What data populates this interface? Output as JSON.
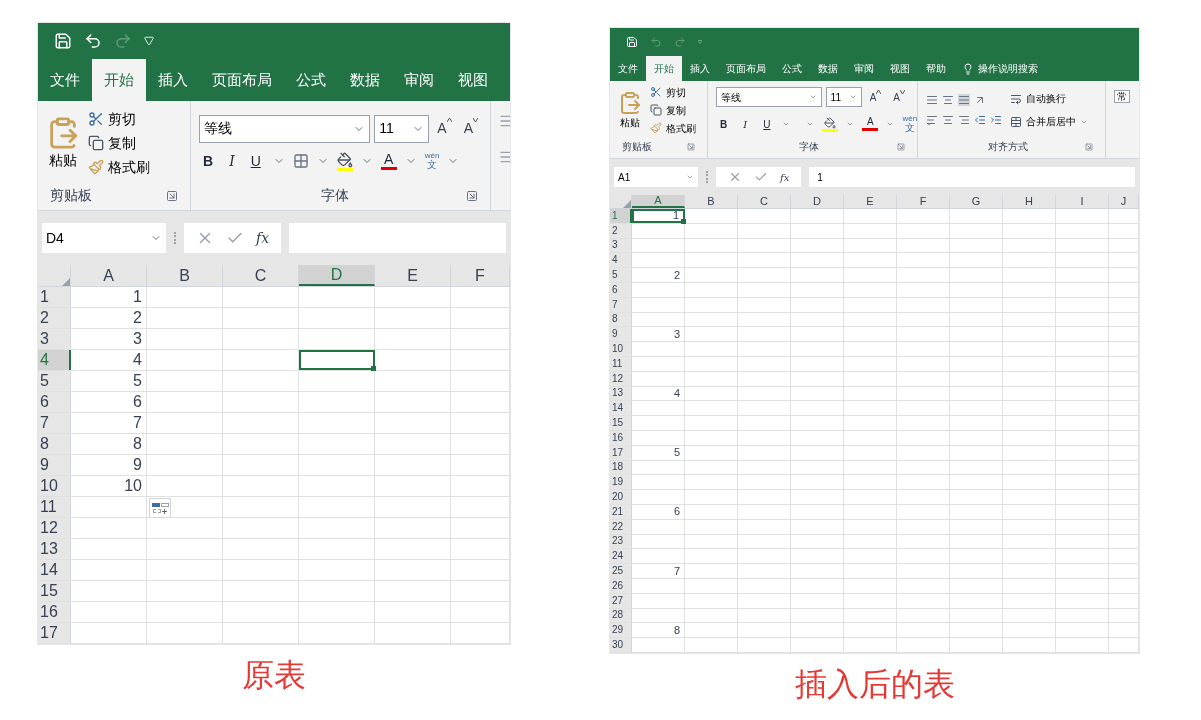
{
  "panels": [
    {
      "quick_access": {
        "undo_enabled": true,
        "redo_enabled": false
      },
      "tabs": [
        {
          "label": "文件",
          "selected": false
        },
        {
          "label": "开始",
          "selected": true
        },
        {
          "label": "插入",
          "selected": false
        },
        {
          "label": "页面布局",
          "selected": false
        },
        {
          "label": "公式",
          "selected": false
        },
        {
          "label": "数据",
          "selected": false
        },
        {
          "label": "审阅",
          "selected": false
        },
        {
          "label": "视图",
          "selected": false
        }
      ],
      "clipboard": {
        "paste": "粘贴",
        "cut": "剪切",
        "copy": "复制",
        "format_painter": "格式刷",
        "group_label": "剪贴板"
      },
      "font": {
        "font_name": "等线",
        "font_size": "11",
        "grow": "A",
        "shrink": "A",
        "bold": "B",
        "italic": "I",
        "underline": "U",
        "font_color": "A",
        "phonetic_pinyin": "wén",
        "phonetic_char": "文",
        "group_label": "字体"
      },
      "name_box": "D4",
      "function_label": "fx",
      "columns": [
        {
          "label": "A",
          "selected": false
        },
        {
          "label": "B",
          "selected": false
        },
        {
          "label": "C",
          "selected": false
        },
        {
          "label": "D",
          "selected": true
        },
        {
          "label": "E",
          "selected": false
        },
        {
          "label": "F",
          "selected": false
        }
      ],
      "rows": [
        {
          "label": "1",
          "selected": false,
          "value": "1"
        },
        {
          "label": "2",
          "selected": false,
          "value": "2"
        },
        {
          "label": "3",
          "selected": false,
          "value": "3"
        },
        {
          "label": "4",
          "selected": true,
          "value": "4"
        },
        {
          "label": "5",
          "selected": false,
          "value": "5"
        },
        {
          "label": "6",
          "selected": false,
          "value": "6"
        },
        {
          "label": "7",
          "selected": false,
          "value": "7"
        },
        {
          "label": "8",
          "selected": false,
          "value": "8"
        },
        {
          "label": "9",
          "selected": false,
          "value": "9"
        },
        {
          "label": "10",
          "selected": false,
          "value": "10"
        },
        {
          "label": "11",
          "selected": false,
          "paste_options": true
        },
        {
          "label": "12",
          "selected": false
        },
        {
          "label": "13",
          "selected": false
        },
        {
          "label": "14",
          "selected": false
        },
        {
          "label": "15",
          "selected": false
        },
        {
          "label": "16",
          "selected": false
        },
        {
          "label": "17",
          "selected": false
        }
      ],
      "caption": "原表"
    },
    {
      "quick_access": {
        "undo_enabled": false,
        "redo_enabled": false
      },
      "tabs": [
        {
          "label": "文件",
          "selected": false
        },
        {
          "label": "开始",
          "selected": true
        },
        {
          "label": "插入",
          "selected": false
        },
        {
          "label": "页面布局",
          "selected": false
        },
        {
          "label": "公式",
          "selected": false
        },
        {
          "label": "数据",
          "selected": false
        },
        {
          "label": "审阅",
          "selected": false
        },
        {
          "label": "视图",
          "selected": false
        },
        {
          "label": "帮助",
          "selected": false
        }
      ],
      "tell_me": "操作说明搜索",
      "clipboard": {
        "paste": "粘贴",
        "cut": "剪切",
        "copy": "复制",
        "format_painter": "格式刷",
        "group_label": "剪贴板"
      },
      "font": {
        "font_name": "等线",
        "font_size": "11",
        "grow": "A",
        "shrink": "A",
        "bold": "B",
        "italic": "I",
        "underline": "U",
        "font_color": "A",
        "phonetic_pinyin": "wén",
        "phonetic_char": "文",
        "group_label": "字体"
      },
      "alignment": {
        "wrap_text": "自动换行",
        "merge_center": "合并后居中",
        "group_label": "对齐方式"
      },
      "number_format": "常",
      "name_box": "A1",
      "function_label": "fx",
      "formula": "1",
      "columns": [
        {
          "label": "A",
          "selected": true
        },
        {
          "label": "B",
          "selected": false
        },
        {
          "label": "C",
          "selected": false
        },
        {
          "label": "D",
          "selected": false
        },
        {
          "label": "E",
          "selected": false
        },
        {
          "label": "F",
          "selected": false
        },
        {
          "label": "G",
          "selected": false
        },
        {
          "label": "H",
          "selected": false
        },
        {
          "label": "I",
          "selected": false
        },
        {
          "label": "J",
          "selected": false
        }
      ],
      "rows": [
        {
          "label": "1",
          "selected": true,
          "value": "1"
        },
        {
          "label": "2",
          "selected": false
        },
        {
          "label": "3",
          "selected": false
        },
        {
          "label": "4",
          "selected": false
        },
        {
          "label": "5",
          "selected": false,
          "value": "2"
        },
        {
          "label": "6",
          "selected": false
        },
        {
          "label": "7",
          "selected": false
        },
        {
          "label": "8",
          "selected": false
        },
        {
          "label": "9",
          "selected": false,
          "value": "3"
        },
        {
          "label": "10",
          "selected": false
        },
        {
          "label": "11",
          "selected": false
        },
        {
          "label": "12",
          "selected": false
        },
        {
          "label": "13",
          "selected": false,
          "value": "4"
        },
        {
          "label": "14",
          "selected": false
        },
        {
          "label": "15",
          "selected": false
        },
        {
          "label": "16",
          "selected": false
        },
        {
          "label": "17",
          "selected": false,
          "value": "5"
        },
        {
          "label": "18",
          "selected": false
        },
        {
          "label": "19",
          "selected": false
        },
        {
          "label": "20",
          "selected": false
        },
        {
          "label": "21",
          "selected": false,
          "value": "6"
        },
        {
          "label": "22",
          "selected": false
        },
        {
          "label": "23",
          "selected": false
        },
        {
          "label": "24",
          "selected": false
        },
        {
          "label": "25",
          "selected": false,
          "value": "7"
        },
        {
          "label": "26",
          "selected": false
        },
        {
          "label": "27",
          "selected": false
        },
        {
          "label": "28",
          "selected": false
        },
        {
          "label": "29",
          "selected": false,
          "value": "8"
        },
        {
          "label": "30",
          "selected": false
        }
      ],
      "caption": "插入后的表"
    }
  ]
}
